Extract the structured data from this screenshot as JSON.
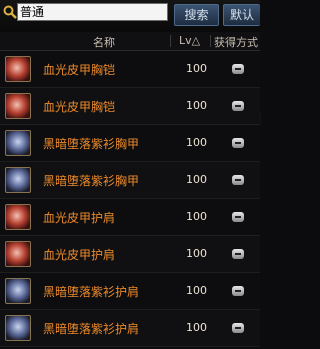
{
  "search": {
    "value": "普通"
  },
  "toolbar": {
    "search_label": "搜索",
    "default_label": "默认"
  },
  "columns": {
    "name": "名称",
    "level": "Lv△",
    "source": "获得方式"
  },
  "items": [
    {
      "name": "血光皮甲胸铠",
      "level": "100",
      "icon": "red-armor-icon"
    },
    {
      "name": "血光皮甲胸铠",
      "level": "100",
      "icon": "red-armor-icon"
    },
    {
      "name": "黑暗堕落紫衫胸甲",
      "level": "100",
      "icon": "dark-armor-icon"
    },
    {
      "name": "黑暗堕落紫衫胸甲",
      "level": "100",
      "icon": "dark-armor-icon"
    },
    {
      "name": "血光皮甲护肩",
      "level": "100",
      "icon": "red-shoulder-icon"
    },
    {
      "name": "血光皮甲护肩",
      "level": "100",
      "icon": "red-shoulder-icon"
    },
    {
      "name": "黑暗堕落紫衫护肩",
      "level": "100",
      "icon": "dark-shoulder-icon"
    },
    {
      "name": "黑暗堕落紫衫护肩",
      "level": "100",
      "icon": "dark-shoulder-icon"
    }
  ],
  "colors": {
    "item_name": "#ec8a2a",
    "button": "#3c5473",
    "background": "#0c0c0e"
  }
}
